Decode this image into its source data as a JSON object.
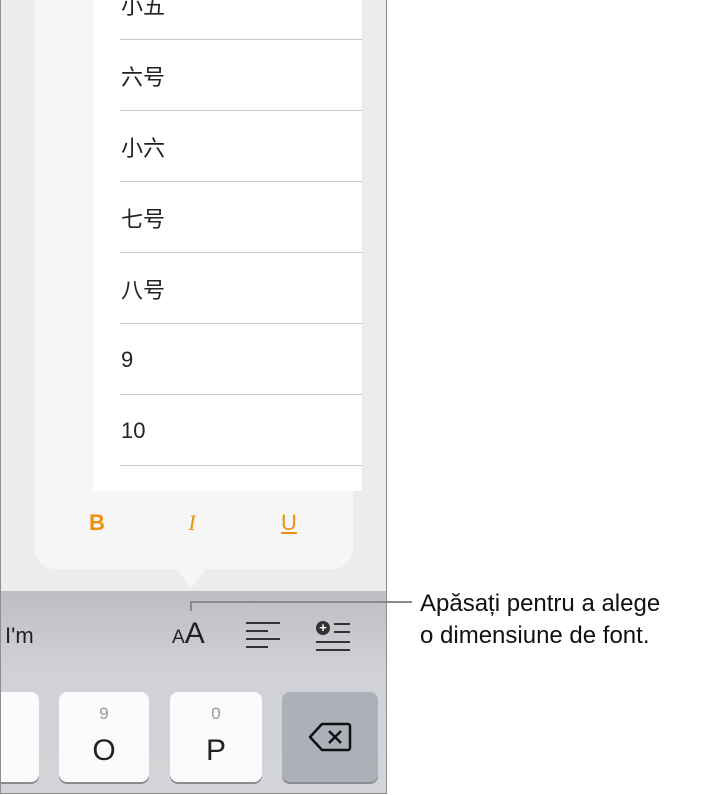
{
  "font_sizes": [
    "小五",
    "六号",
    "小六",
    "七号",
    "八号",
    "9",
    "10"
  ],
  "format": {
    "bold": "B",
    "italic": "I",
    "underline": "U"
  },
  "toolbar": {
    "suggestion": "I'm",
    "size_small": "A",
    "size_large": "A"
  },
  "keys": [
    {
      "sub": "9",
      "main": "O"
    },
    {
      "sub": "0",
      "main": "P"
    }
  ],
  "callout": {
    "line1": "Apăsați pentru a alege",
    "line2": "o dimensiune de font."
  },
  "colors": {
    "accent": "#f0900a"
  }
}
